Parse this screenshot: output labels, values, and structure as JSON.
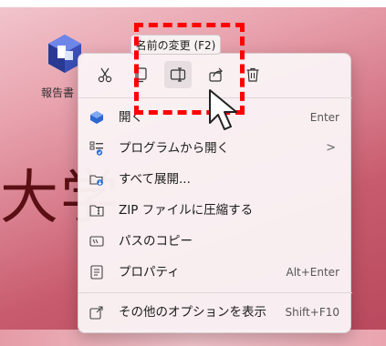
{
  "desktop": {
    "icon_label": "報告書",
    "background_text": "大学"
  },
  "tooltip": {
    "text": "名前の変更 (F2)"
  },
  "toolbar": {
    "buttons": [
      {
        "name": "cut",
        "icon": "scissors-icon"
      },
      {
        "name": "copy",
        "icon": "copy-icon"
      },
      {
        "name": "rename",
        "icon": "rename-icon"
      },
      {
        "name": "share",
        "icon": "share-icon"
      },
      {
        "name": "delete",
        "icon": "trash-icon"
      }
    ]
  },
  "menu": {
    "items": [
      {
        "label": "開く",
        "shortcut": "Enter",
        "icon": "open-app-icon"
      },
      {
        "label": "プログラムから開く",
        "shortcut": ">",
        "icon": "open-with-icon"
      },
      {
        "label": "すべて展開...",
        "shortcut": "",
        "icon": "extract-folder-icon"
      },
      {
        "label": "ZIP ファイルに圧縮する",
        "shortcut": "",
        "icon": "zip-icon"
      },
      {
        "label": "パスのコピー",
        "shortcut": "",
        "icon": "copy-path-icon"
      },
      {
        "label": "プロパティ",
        "shortcut": "Alt+Enter",
        "icon": "properties-icon"
      },
      {
        "label": "その他のオプションを表示",
        "shortcut": "Shift+F10",
        "icon": "more-options-icon"
      }
    ]
  },
  "colors": {
    "highlight": "#ff0000",
    "accent_blue": "#2b6fd6"
  }
}
